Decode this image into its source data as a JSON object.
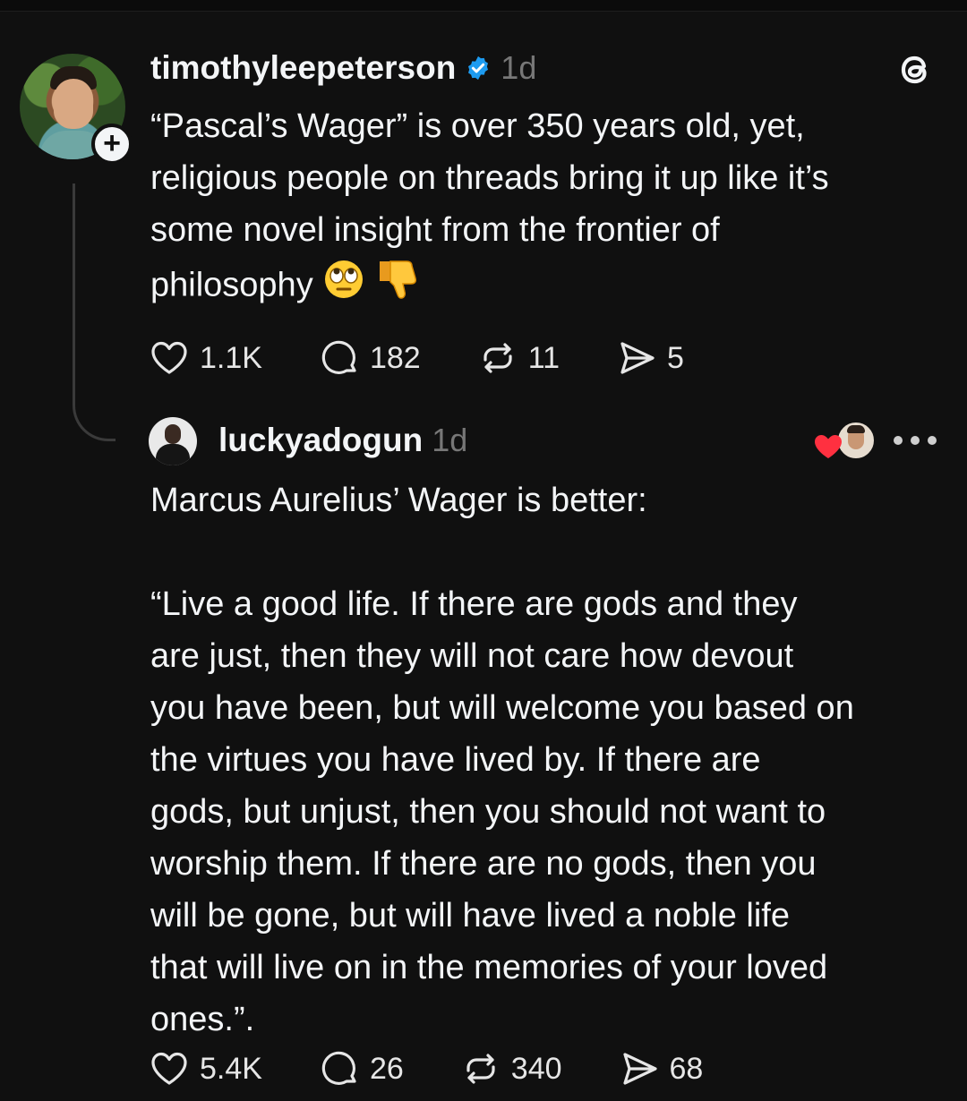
{
  "post": {
    "author": "timothyleepeterson",
    "time": "1d",
    "text": "“Pascal’s Wager” is over 350 years old, yet,\nreligious people on threads bring it up like it’s\nsome novel insight from the frontier of\nphilosophy",
    "emojis": [
      "face-with-rolling-eyes",
      "thumbs-down"
    ],
    "stats": {
      "likes": "1.1K",
      "replies": "182",
      "reposts": "11",
      "shares": "5"
    }
  },
  "reply": {
    "author": "luckyadogun",
    "time": "1d",
    "text": "Marcus Aurelius’ Wager is better:\n\n“Live a good life. If there are gods and they\nare just, then they will not care how devout\nyou have been, but will welcome you based on\nthe virtues you have lived by. If there are\ngods, but unjust, then you should not want to\nworship them. If there are no gods, then you\nwill be gone, but will have lived a noble life\nthat will live on in the memories of your loved\nones.”.",
    "stats": {
      "likes": "5.4K",
      "replies": "26",
      "reposts": "340",
      "shares": "68"
    }
  },
  "colors": {
    "background": "#101010",
    "text": "#f3f5f7",
    "muted": "#777777",
    "verified": "#1d9bf0",
    "heart": "#ff3040"
  },
  "icons": [
    "threads-logo-icon",
    "verified-badge-icon",
    "heart-icon",
    "comment-icon",
    "repost-icon",
    "share-icon",
    "more-icon",
    "follow-plus-icon"
  ]
}
